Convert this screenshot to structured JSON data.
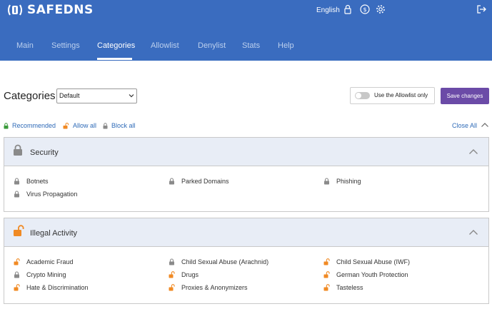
{
  "header": {
    "logo_text": "SAFEDNS",
    "language": "English",
    "icons": [
      "lock-icon",
      "dollar-icon",
      "gear-icon",
      "logout-icon"
    ]
  },
  "nav": {
    "tabs": [
      {
        "label": "Main",
        "active": false
      },
      {
        "label": "Settings",
        "active": false
      },
      {
        "label": "Categories",
        "active": true
      },
      {
        "label": "Allowlist",
        "active": false
      },
      {
        "label": "Denylist",
        "active": false
      },
      {
        "label": "Stats",
        "active": false
      },
      {
        "label": "Help",
        "active": false
      }
    ]
  },
  "toolbar": {
    "title": "Categories",
    "profile_select": "Default",
    "allowlist_toggle_label": "Use the Allowlist only",
    "allowlist_toggle_on": false,
    "save_label": "Save changes"
  },
  "actions": {
    "recommended": "Recommended",
    "allow_all": "Allow all",
    "block_all": "Block all",
    "close_all": "Close All"
  },
  "colors": {
    "header_bg": "#3a6cbf",
    "save_button": "#6b4ba7",
    "link": "#2f6bb8",
    "locked": "#8a8a8a",
    "allowed": "#f08a24",
    "recommended": "#3a9a3a"
  },
  "groups": [
    {
      "title": "Security",
      "state": "locked",
      "items": [
        {
          "label": "Botnets",
          "state": "locked"
        },
        {
          "label": "Parked Domains",
          "state": "locked"
        },
        {
          "label": "Phishing",
          "state": "locked"
        },
        {
          "label": "Virus Propagation",
          "state": "locked"
        }
      ]
    },
    {
      "title": "Illegal Activity",
      "state": "unlocked",
      "items": [
        {
          "label": "Academic Fraud",
          "state": "unlocked"
        },
        {
          "label": "Child Sexual Abuse (Arachnid)",
          "state": "locked"
        },
        {
          "label": "Child Sexual Abuse (IWF)",
          "state": "unlocked"
        },
        {
          "label": "Crypto Mining",
          "state": "locked"
        },
        {
          "label": "Drugs",
          "state": "unlocked"
        },
        {
          "label": "German Youth Protection",
          "state": "unlocked"
        },
        {
          "label": "Hate & Discrimination",
          "state": "unlocked"
        },
        {
          "label": "Proxies & Anonymizers",
          "state": "unlocked"
        },
        {
          "label": "Tasteless",
          "state": "unlocked"
        }
      ]
    }
  ]
}
